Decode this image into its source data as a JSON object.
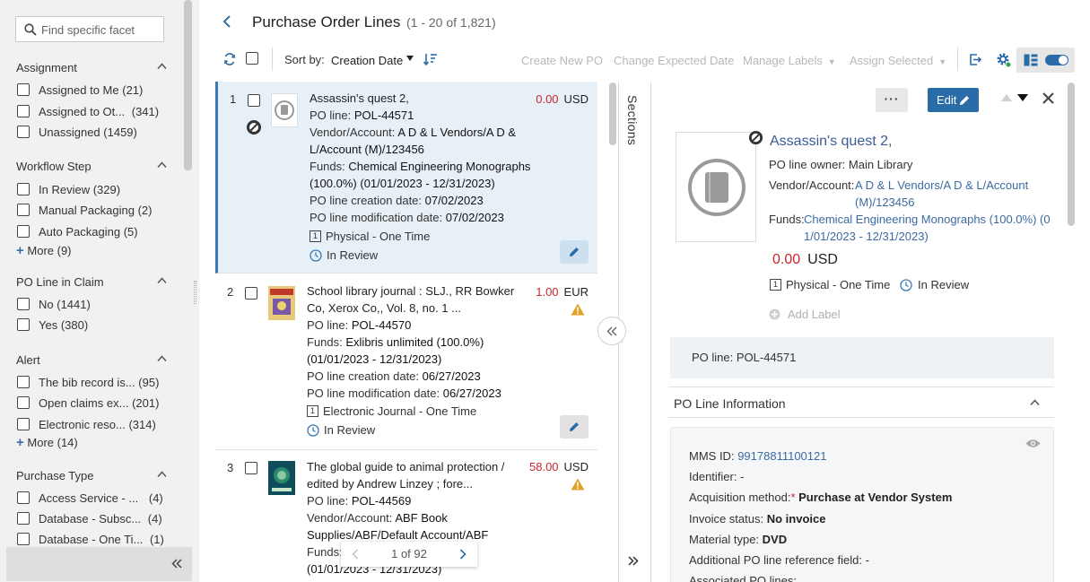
{
  "facets": {
    "search_placeholder": "Find specific facet",
    "groups": [
      {
        "title": "Assignment",
        "items": [
          {
            "label": "Assigned to Me",
            "count": "(21)"
          },
          {
            "label": "Assigned to Ot...",
            "count": "(341)"
          },
          {
            "label": "Unassigned",
            "count": "(1459)"
          }
        ]
      },
      {
        "title": "Workflow Step",
        "items": [
          {
            "label": "In Review",
            "count": "(329)"
          },
          {
            "label": "Manual Packaging",
            "count": "(2)"
          },
          {
            "label": "Auto Packaging",
            "count": "(5)"
          }
        ],
        "more": "More (9)"
      },
      {
        "title": "PO Line in Claim",
        "items": [
          {
            "label": "No",
            "count": "(1441)"
          },
          {
            "label": "Yes",
            "count": "(380)"
          }
        ]
      },
      {
        "title": "Alert",
        "items": [
          {
            "label": "The bib record is...",
            "count": "(95)"
          },
          {
            "label": "Open claims ex...",
            "count": "(201)"
          },
          {
            "label": "Electronic reso...",
            "count": "(314)"
          }
        ],
        "more": "More (14)"
      },
      {
        "title": "Purchase Type",
        "items": [
          {
            "label": "Access Service - ...",
            "count": "(4)"
          },
          {
            "label": "Database - Subsc...",
            "count": "(4)"
          },
          {
            "label": "Database - One Ti...",
            "count": "(1)"
          }
        ]
      }
    ]
  },
  "header": {
    "title": "Purchase Order Lines",
    "count": "(1 - 20 of 1,821)"
  },
  "toolbar": {
    "sort_label": "Sort by:",
    "sort_value": "Creation Date",
    "actions": [
      "Create New PO",
      "Change Expected Date",
      "Manage Labels",
      "Assign Selected"
    ]
  },
  "rows": [
    {
      "num": "1",
      "title": "Assassin's quest 2,",
      "amount": "0.00",
      "currency": "USD",
      "po_line_label": "PO line:",
      "po_line": "POL-44571",
      "vendor_label": "Vendor/Account:",
      "vendor_1": "A D & L Vendors/A D &",
      "vendor_2": "L/Account (M)/123456",
      "funds_label": "Funds:",
      "funds_1": "Chemical Engineering Monographs",
      "funds_2": "(100.0%) (01/01/2023 - 12/31/2023)",
      "created_label": "PO line creation date:",
      "created": "07/02/2023",
      "modified_label": "PO line modification date:",
      "modified": "07/02/2023",
      "type": "Physical - One Time",
      "status": "In Review"
    },
    {
      "num": "2",
      "title_1": "School library journal : SLJ., RR Bowker",
      "title_2": "Co, Xerox Co,, Vol. 8, no. 1 ...",
      "amount": "1.00",
      "currency": "EUR",
      "po_line_label": "PO line:",
      "po_line": "POL-44570",
      "funds_label": "Funds:",
      "funds_1": "Exlibris unlimited (100.0%)",
      "funds_2": "(01/01/2023 - 12/31/2023)",
      "created_label": "PO line creation date:",
      "created": "06/27/2023",
      "modified_label": "PO line modification date:",
      "modified": "06/27/2023",
      "type": "Electronic Journal - One Time",
      "status": "In Review"
    },
    {
      "num": "3",
      "title_1": "The global guide to animal protection /",
      "title_2": "edited by Andrew Linzey ; fore...",
      "amount": "58.00",
      "currency": "USD",
      "po_line_label": "PO line:",
      "po_line": "POL-44569",
      "vendor_label": "Vendor/Account:",
      "vendor_1": "ABF Book",
      "vendor_2": "Supplies/ABF/Default Account/ABF",
      "funds_label": "Funds:",
      "funds_2": "(01/01/2023 - 12/31/2023)"
    }
  ],
  "pager": {
    "text": "1 of 92"
  },
  "sections_label": "Sections",
  "detail": {
    "edit_label": "Edit",
    "title": "Assassin's quest 2,",
    "owner_label": "PO line owner:",
    "owner": "Main Library",
    "vendor_label": "Vendor/Account:",
    "vendor_1": "A D & L Vendors/A D & L/Account",
    "vendor_2": "(M)/123456",
    "funds_label": "Funds:",
    "funds_1": "Chemical Engineering Monographs (100.0%) (0",
    "funds_2": "1/01/2023 - 12/31/2023)",
    "amount": "0.00",
    "currency": "USD",
    "type": "Physical - One Time",
    "status": "In Review",
    "add_label": "Add Label",
    "po_line_box": "PO line: POL-44571",
    "section_title": "PO Line Information",
    "info": {
      "mms_label": "MMS ID:",
      "mms": "99178811100121",
      "identifier_label": "Identifier:",
      "identifier": "-",
      "acq_label": "Acquisition method:",
      "acq_req": "*",
      "acq": "Purchase at Vendor System",
      "invoice_label": "Invoice status:",
      "invoice": "No invoice",
      "material_label": "Material type:",
      "material": "DVD",
      "additional_label": "Additional PO line reference field:",
      "additional": "-",
      "associated_label": "Associated PO lines:"
    }
  },
  "colors": {
    "accent": "#2a6ca8",
    "price": "#c8272d",
    "link": "#3b6aa3",
    "selected_row": "#e8f0f7"
  }
}
